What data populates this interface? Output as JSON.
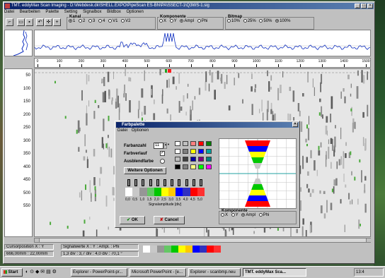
{
  "window": {
    "title": "TMT. eddyMax Scan Imaging - D:\\Webdesk.dk\\SHELL.EXPO\\PipeScan ES-BN\\PA\\SSECT-1\\Q3WS-1.sig",
    "menu": [
      "Datei",
      "Bearbeiten",
      "Palette",
      "Setting",
      "Signalbox",
      "Bildbox",
      "Optionen"
    ]
  },
  "toolbar": {
    "kanal": {
      "legend": "Kanal",
      "options": [
        "1",
        "2",
        "3",
        "4",
        "V1",
        "V2"
      ],
      "selected": "1"
    },
    "komponente": {
      "legend": "Komponente",
      "options": [
        "X",
        "Y",
        "Ampl",
        "Phi"
      ],
      "selected": "Ampl"
    },
    "bitmap": {
      "legend": "Bitmap",
      "options": [
        "10%",
        "25%",
        "50%",
        "100%"
      ],
      "selected": "100%"
    }
  },
  "ruler": {
    "ticks": [
      "0",
      "100",
      "200",
      "300",
      "400",
      "500",
      "600",
      "700",
      "800",
      "900",
      "1000",
      "1100",
      "1200",
      "1300",
      "1400",
      "1500"
    ]
  },
  "yaxis": {
    "ticks": [
      "50",
      "100",
      "150",
      "200",
      "250",
      "300",
      "350",
      "400",
      "450",
      "500",
      "550"
    ]
  },
  "status": {
    "cursor_label": "Cursorposition X : Y",
    "cursor_value": "666,00mm : 22,00mm",
    "signal_label": "Signalwerte X : Y : Ampl. : Phi",
    "signal_value": "1,3 div : 3,7 div : 4,0 div : 70,1 °"
  },
  "dialog": {
    "title": "Farbpalette",
    "menu": [
      "Datei",
      "Optionen"
    ],
    "farbanzahl_label": "Farbanzahl",
    "farbanzahl_value": "11",
    "farbverlauf_label": "Farbverlauf",
    "ausblendfarbe_label": "Ausblendfarbe",
    "weitere_label": "Weitere Optionen",
    "scale_ticks": [
      "0,0",
      "0,5",
      "1,0",
      "1,5",
      "2,0",
      "2,5",
      "3,0",
      "3,5",
      "4,0",
      "4,5",
      "5,0"
    ],
    "scale_label": "Signalamplitude [div]",
    "komponente_legend": "Komponente",
    "komponente_options": [
      "X",
      "Y",
      "Ampl",
      "Phi"
    ],
    "komponente_selected": "Ampl",
    "ok_label": "OK",
    "cancel_label": "Cancel",
    "swatches": [
      "#ffffff",
      "#c0c0c0",
      "#ff8080",
      "#ff0000",
      "#008000",
      "#ffffff",
      "#808080",
      "#ffff00",
      "#0000ff",
      "#00a0a0",
      "#c0c0c0",
      "#404040",
      "#0000a0",
      "#800080",
      "#008080",
      "#000000",
      "#808080",
      "#ffff80",
      "#00ff00",
      "#ff00ff"
    ],
    "palette_colors": [
      "#ffffff",
      "#c8c8c8",
      "#969696",
      "#64c864",
      "#00c800",
      "#ffff00",
      "#ffc800",
      "#0000ff",
      "#3030c0",
      "#ff0000",
      "#ff3030"
    ]
  },
  "taskbar": {
    "start": "Start",
    "tasks": [
      "Explorer - PowerPoint-pr...",
      "Microsoft PowerPoint - [e...",
      "Explorer - scanbmp.neu",
      "TMT. eddyMax Sca...",
      "13:4"
    ]
  },
  "colors": {
    "accent": "#0a246a",
    "trace": "#1030c0"
  }
}
